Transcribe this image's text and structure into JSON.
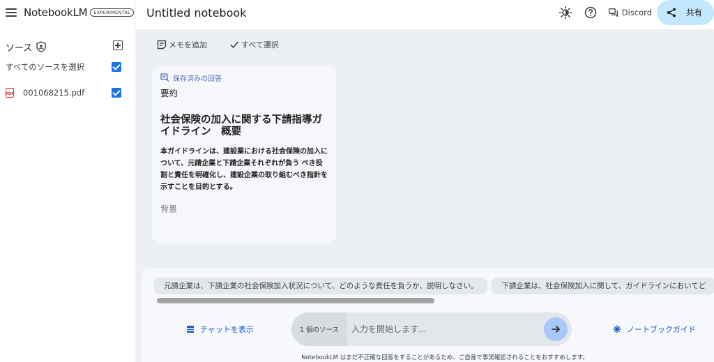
{
  "brand": {
    "name": "NotebookLM",
    "badge": "EXPERIMENTAL"
  },
  "sidebar": {
    "sources_label": "ソース",
    "select_all_label": "すべてのソースを選択",
    "sources": [
      {
        "name": "001068215.pdf",
        "type_badge": "PDF",
        "checked": true
      }
    ]
  },
  "topbar": {
    "notebook_title": "Untitled notebook",
    "discord_label": "Discord",
    "share_label": "共有"
  },
  "toolbar": {
    "add_note_label": "メモを追加",
    "select_all_label": "すべて選択"
  },
  "note": {
    "tag": "保存済みの回答",
    "heading": "要約",
    "title": "社会保険の加入に関する下請指導ガイドライン　概要",
    "body": "本ガイドラインは、建設業における社会保険の加入について、元請企業と下請企業それぞれが負う べき役割と責任を明確化し、建設企業の取り組むべき指針を示すことを目的とする。",
    "footer": "背景"
  },
  "chat": {
    "suggestions": [
      "元請企業は、下請企業の社会保険加入状況について、どのような責任を負うか、説明しなさい。",
      "下請企業は、社会保険加入に関して、ガイドラインにおいてど"
    ],
    "show_chat_label": "チャットを表示",
    "source_count": "1 個のソース",
    "input_placeholder": "入力を開始します...",
    "notebook_guide_label": "ノートブックガイド",
    "disclaimer": "NotebookLM はまだ不正確な回答をすることがあるため、ご自身で事実確認されることをおすすめします。"
  },
  "colors": {
    "accent": "#1a73e8",
    "share_bg": "#c2e7ff",
    "send_bg": "#a8c7fa",
    "main_bg": "#eceff3"
  }
}
